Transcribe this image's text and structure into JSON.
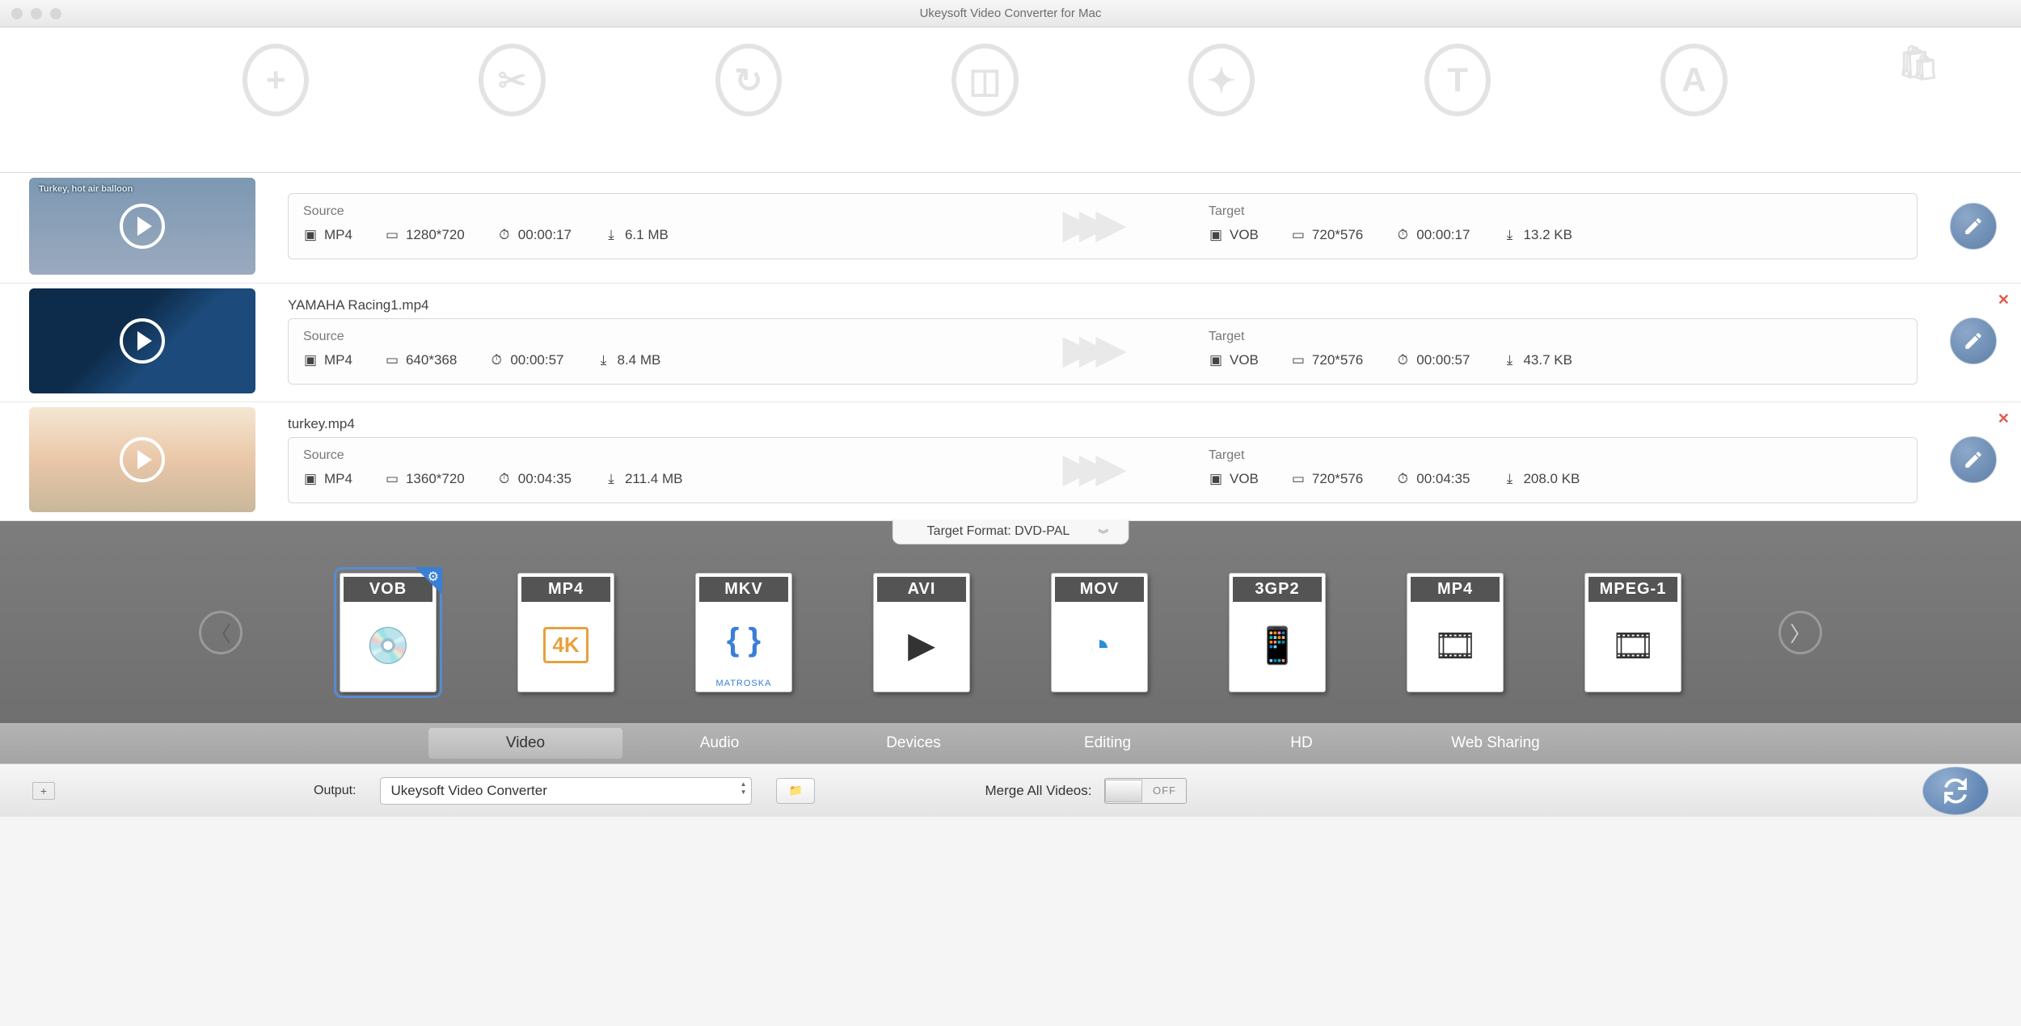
{
  "window": {
    "title": "Ukeysoft Video Converter for Mac"
  },
  "items": [
    {
      "filename": "",
      "thumb_label": "Turkey, hot air balloon",
      "source": {
        "fmt": "MP4",
        "res": "1280*720",
        "dur": "00:00:17",
        "size": "6.1 MB"
      },
      "target": {
        "fmt": "VOB",
        "res": "720*576",
        "dur": "00:00:17",
        "size": "13.2 KB"
      },
      "show_close": false
    },
    {
      "filename": "YAMAHA Racing1.mp4",
      "thumb_label": "",
      "source": {
        "fmt": "MP4",
        "res": "640*368",
        "dur": "00:00:57",
        "size": "8.4 MB"
      },
      "target": {
        "fmt": "VOB",
        "res": "720*576",
        "dur": "00:00:57",
        "size": "43.7 KB"
      },
      "show_close": true
    },
    {
      "filename": "turkey.mp4",
      "thumb_label": "",
      "source": {
        "fmt": "MP4",
        "res": "1360*720",
        "dur": "00:04:35",
        "size": "211.4 MB"
      },
      "target": {
        "fmt": "VOB",
        "res": "720*576",
        "dur": "00:04:35",
        "size": "208.0 KB"
      },
      "show_close": true
    }
  ],
  "labels": {
    "source": "Source",
    "target": "Target",
    "target_format": "Target Format: DVD-PAL",
    "output": "Output:",
    "merge": "Merge All Videos:",
    "off": "OFF"
  },
  "formats": [
    {
      "top": "VOB",
      "sub": "",
      "selected": true,
      "emoji": "💿"
    },
    {
      "top": "MP4",
      "sub": "4K",
      "selected": false,
      "emoji": ""
    },
    {
      "top": "MKV",
      "sub": "MATROSKA",
      "selected": false,
      "emoji": "{ }"
    },
    {
      "top": "AVI",
      "sub": "",
      "selected": false,
      "emoji": "▶"
    },
    {
      "top": "MOV",
      "sub": "",
      "selected": false,
      "emoji": "Q"
    },
    {
      "top": "3GP2",
      "sub": "",
      "selected": false,
      "emoji": "📱"
    },
    {
      "top": "MP4",
      "sub": "",
      "selected": false,
      "emoji": "🎞"
    },
    {
      "top": "MPEG-1",
      "sub": "",
      "selected": false,
      "emoji": "🎞"
    }
  ],
  "tabs": [
    "Video",
    "Audio",
    "Devices",
    "Editing",
    "HD",
    "Web Sharing"
  ],
  "active_tab": 0,
  "output_path": "Ukeysoft Video Converter"
}
